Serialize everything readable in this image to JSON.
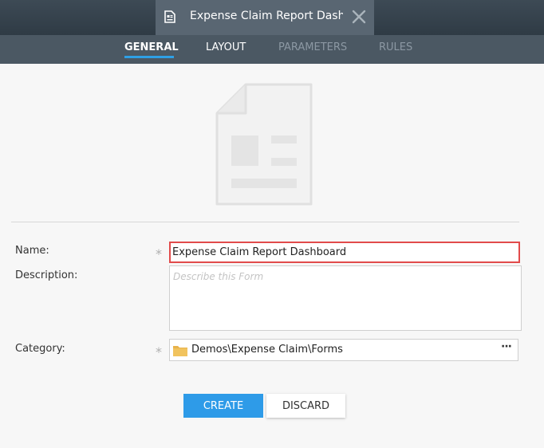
{
  "window": {
    "tab_title": "Expense Claim Report Dash…",
    "tab_icon": "form-document-icon",
    "close_icon": "close-icon"
  },
  "nav_tabs": [
    {
      "label": "GENERAL",
      "state": "active"
    },
    {
      "label": "LAYOUT",
      "state": "normal"
    },
    {
      "label": "PARAMETERS",
      "state": "disabled"
    },
    {
      "label": "RULES",
      "state": "disabled"
    }
  ],
  "form": {
    "name_label": "Name:",
    "name_value": "Expense Claim Report Dashboard",
    "description_label": "Description:",
    "description_placeholder": "Describe this Form",
    "category_label": "Category:",
    "category_value": "Demos\\Expense Claim\\Forms",
    "category_browse": "···",
    "required_marker": "*"
  },
  "buttons": {
    "create": "CREATE",
    "discard": "DISCARD"
  },
  "colors": {
    "accent": "#2e9be8",
    "error_border": "#e24b4b",
    "title_bar": "#2f3b45",
    "tab_bar": "#4b5863"
  }
}
